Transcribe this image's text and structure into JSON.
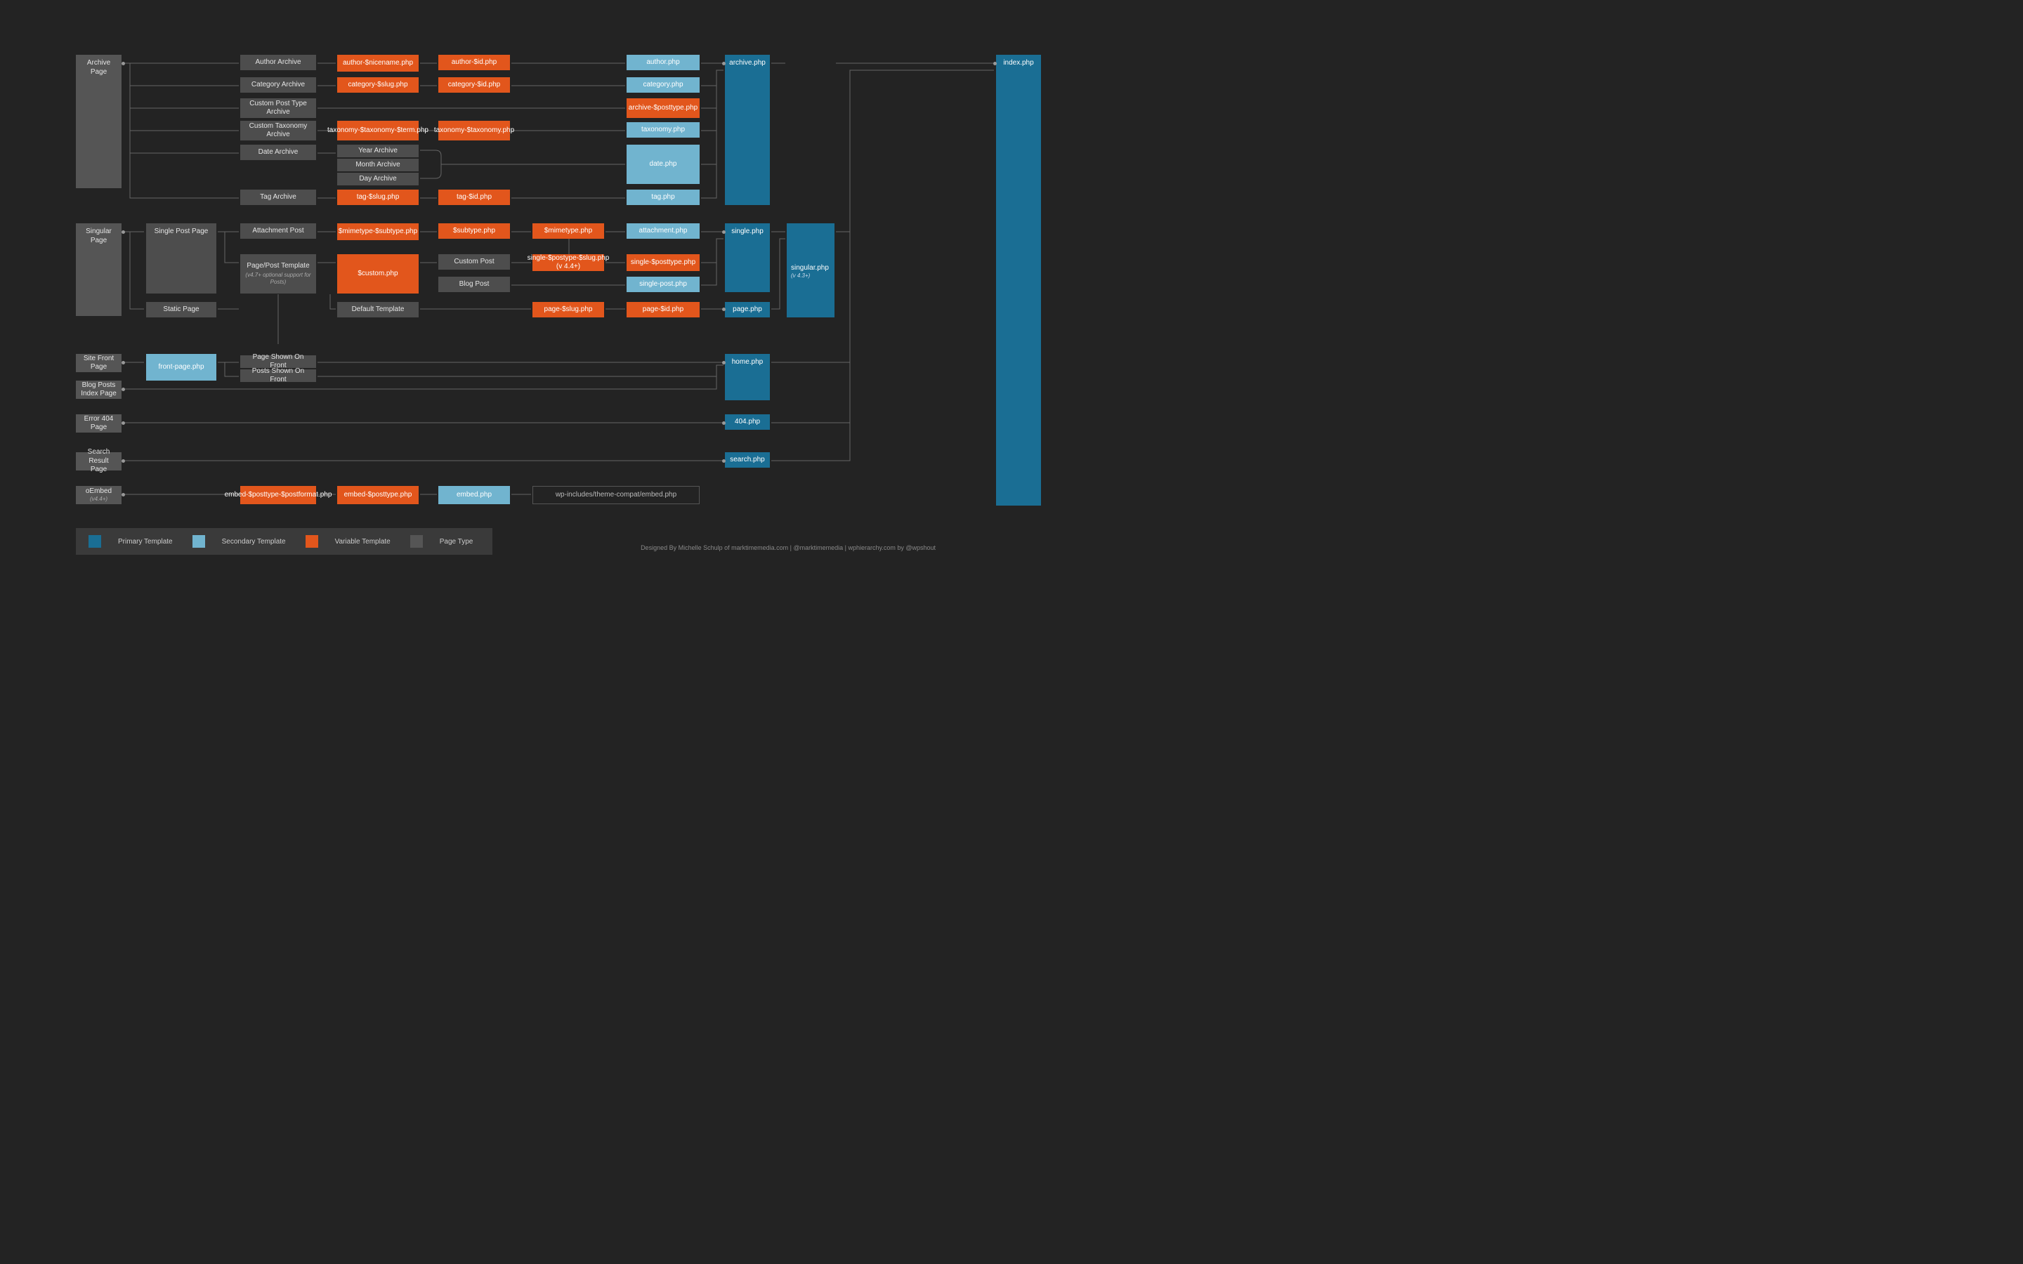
{
  "boxes": {
    "archivePage": "Archive Page",
    "authorArchive": "Author Archive",
    "categoryArchive": "Category Archive",
    "cptArchive": "Custom Post Type Archive",
    "customTaxArchive": "Custom Taxonomy Archive",
    "dateArchive": "Date Archive",
    "yearArchive": "Year Archive",
    "monthArchive": "Month Archive",
    "dayArchive": "Day Archive",
    "tagArchive": "Tag Archive",
    "singularPage": "Singular Page",
    "singlePostPage": "Single Post Page",
    "staticPage": "Static Page",
    "attachmentPost": "Attachment Post",
    "pagePostTemplate": "Page/Post Template",
    "pagePostTemplateNote": "(v4.7+ optional support for Posts)",
    "customPost": "Custom Post",
    "blogPost": "Blog Post",
    "defaultTemplate": "Default Template",
    "siteFrontPage": "Site Front Page",
    "pageShownOnFront": "Page Shown On Front",
    "postsShownOnFront": "Posts Shown On Front",
    "blogPostsIndex": "Blog Posts Index Page",
    "error404Page": "Error 404 Page",
    "searchResultPage": "Search Result Page",
    "oembed": "oEmbed",
    "oembedNote": "(v4.4+)"
  },
  "orange": {
    "authorNicename": "author-$nicename.php",
    "authorId": "author-$id.php",
    "categorySlug": "category-$slug.php",
    "categoryId": "category-$id.php",
    "archivePosttype": "archive-$posttype.php",
    "taxTerm": "taxonomy-$taxonomy-$term.php",
    "taxOnly": "taxonomy-$taxonomy.php",
    "tagSlug": "tag-$slug.php",
    "tagId": "tag-$id.php",
    "mimeSubtype": "$mimetype-$subtype.php",
    "subtype": "$subtype.php",
    "mimetype": "$mimetype.php",
    "custom": "$custom.php",
    "singlePostSlug": "single-$postype-$slug.php (v 4.4+)",
    "singlePosttype": "single-$posttype.php",
    "pageSlug": "page-$slug.php",
    "pageId": "page-$id.php",
    "embedPostFormat": "embed-$posttype-$postformat.php",
    "embedPosttype": "embed-$posttype.php"
  },
  "lightblue": {
    "author": "author.php",
    "category": "category.php",
    "taxonomy": "taxonomy.php",
    "date": "date.php",
    "tag": "tag.php",
    "attachment": "attachment.php",
    "singlePost": "single-post.php",
    "frontPage": "front-page.php",
    "embed": "embed.php"
  },
  "blue": {
    "archive": "archive.php",
    "single": "single.php",
    "singular": "singular.php",
    "singularNote": "(v 4.3+)",
    "page": "page.php",
    "home": "home.php",
    "e404": "404.php",
    "search": "search.php",
    "index": "index.php"
  },
  "outline": {
    "embedCompat": "wp-includes/theme-compat/embed.php"
  },
  "legend": {
    "primary": "Primary Template",
    "secondary": "Secondary Template",
    "variable": "Variable Template",
    "pageType": "Page Type"
  },
  "credit": "Designed By Michelle Schulp of marktimemedia.com  |  @marktimemedia  |  wphierarchy.com by @wpshout"
}
